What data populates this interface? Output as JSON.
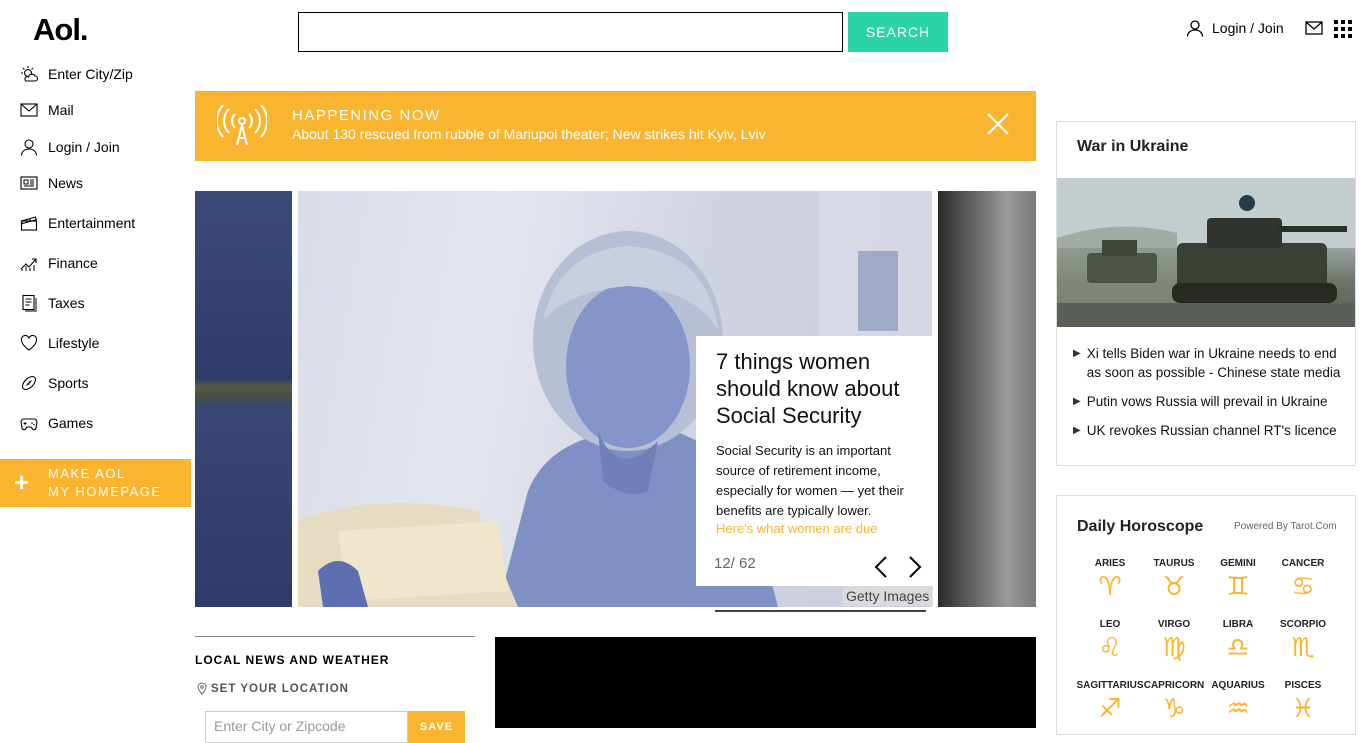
{
  "header": {
    "logo": "Aol.",
    "search_placeholder": "",
    "search_button": "SEARCH",
    "login_label": "Login / Join"
  },
  "sidebar": {
    "items": [
      {
        "label": "Enter City/Zip",
        "icon": "weather-icon"
      },
      {
        "label": "Mail",
        "icon": "mail-icon"
      },
      {
        "label": "Login / Join",
        "icon": "user-icon"
      },
      {
        "label": "News",
        "icon": "news-icon"
      },
      {
        "label": "Entertainment",
        "icon": "clapper-icon"
      },
      {
        "label": "Finance",
        "icon": "chart-icon"
      },
      {
        "label": "Taxes",
        "icon": "document-icon"
      },
      {
        "label": "Lifestyle",
        "icon": "heart-icon"
      },
      {
        "label": "Sports",
        "icon": "football-icon"
      },
      {
        "label": "Games",
        "icon": "gamepad-icon"
      }
    ],
    "homepage_button": {
      "line1": "MAKE AOL",
      "line2": "MY HOMEPAGE"
    }
  },
  "banner": {
    "heading": "HAPPENING NOW",
    "text": "About 130 rescued from rubble of Mariupol theater; New strikes hit Kyiv, Lviv"
  },
  "carousel": {
    "title": "7 things women should know about Social Security",
    "body": "Social Security is an important source of retirement income, especially for women — yet their benefits are typically lower.",
    "link": "Here's what women are due",
    "counter": "12/ 62",
    "credit": "Getty Images"
  },
  "local": {
    "heading": "LOCAL NEWS AND WEATHER",
    "set_location": "SET YOUR LOCATION",
    "input_placeholder": "Enter City or Zipcode",
    "save_button": "SAVE"
  },
  "ukraine": {
    "title": "War in Ukraine",
    "items": [
      "Xi tells Biden war in Ukraine needs to end as soon as possible - Chinese state media",
      "Putin vows Russia will prevail in Ukraine",
      "UK revokes Russian channel RT's licence"
    ]
  },
  "horoscope": {
    "title": "Daily Horoscope",
    "powered_by": "Powered By Tarot.Com",
    "signs": [
      {
        "name": "ARIES",
        "glyph": "♈"
      },
      {
        "name": "TAURUS",
        "glyph": "♉"
      },
      {
        "name": "GEMINI",
        "glyph": "♊"
      },
      {
        "name": "CANCER",
        "glyph": "♋"
      },
      {
        "name": "LEO",
        "glyph": "♌"
      },
      {
        "name": "VIRGO",
        "glyph": "♍"
      },
      {
        "name": "LIBRA",
        "glyph": "♎"
      },
      {
        "name": "SCORPIO",
        "glyph": "♏"
      },
      {
        "name": "SAGITTARIUS",
        "glyph": "♐"
      },
      {
        "name": "CAPRICORN",
        "glyph": "♑"
      },
      {
        "name": "AQUARIUS",
        "glyph": "♒"
      },
      {
        "name": "PISCES",
        "glyph": "♓"
      }
    ]
  },
  "colors": {
    "accent_yellow": "#f9b52f",
    "search_green": "#2bd4a4"
  }
}
